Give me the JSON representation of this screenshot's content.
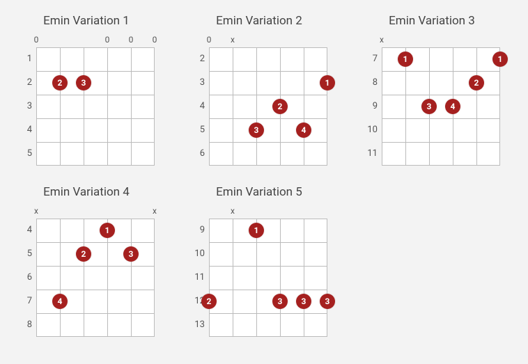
{
  "chart_data": [
    {
      "title": "Emin Variation 1",
      "frets": [
        1,
        2,
        3,
        4,
        5
      ],
      "markers": [
        "0",
        "",
        "",
        "0",
        "0",
        "0"
      ],
      "dots": [
        {
          "finger": "2",
          "string": 2,
          "fret": 2
        },
        {
          "finger": "3",
          "string": 3,
          "fret": 2
        }
      ]
    },
    {
      "title": "Emin Variation 2",
      "frets": [
        2,
        3,
        4,
        5,
        6
      ],
      "markers": [
        "0",
        "x",
        "",
        "",
        "",
        ""
      ],
      "dots": [
        {
          "finger": "1",
          "string": 6,
          "fret": 3
        },
        {
          "finger": "2",
          "string": 4,
          "fret": 4
        },
        {
          "finger": "3",
          "string": 3,
          "fret": 5
        },
        {
          "finger": "4",
          "string": 5,
          "fret": 5
        }
      ]
    },
    {
      "title": "Emin Variation 3",
      "frets": [
        7,
        8,
        9,
        10,
        11
      ],
      "markers": [
        "x",
        "",
        "",
        "",
        "",
        ""
      ],
      "dots": [
        {
          "finger": "1",
          "string": 2,
          "fret": 7
        },
        {
          "finger": "1",
          "string": 6,
          "fret": 7
        },
        {
          "finger": "2",
          "string": 5,
          "fret": 8
        },
        {
          "finger": "3",
          "string": 3,
          "fret": 9
        },
        {
          "finger": "4",
          "string": 4,
          "fret": 9
        }
      ]
    },
    {
      "title": "Emin Variation 4",
      "frets": [
        4,
        5,
        6,
        7,
        8
      ],
      "markers": [
        "x",
        "",
        "",
        "",
        "",
        "x"
      ],
      "dots": [
        {
          "finger": "1",
          "string": 4,
          "fret": 4
        },
        {
          "finger": "2",
          "string": 3,
          "fret": 5
        },
        {
          "finger": "3",
          "string": 5,
          "fret": 5
        },
        {
          "finger": "4",
          "string": 2,
          "fret": 7
        }
      ]
    },
    {
      "title": "Emin Variation 5",
      "frets": [
        9,
        10,
        11,
        12,
        13
      ],
      "markers": [
        "",
        "x",
        "",
        "",
        "",
        ""
      ],
      "dots": [
        {
          "finger": "1",
          "string": 3,
          "fret": 9
        },
        {
          "finger": "2",
          "string": 1,
          "fret": 12
        },
        {
          "finger": "3",
          "string": 4,
          "fret": 12
        },
        {
          "finger": "3",
          "string": 5,
          "fret": 12
        },
        {
          "finger": "3",
          "string": 6,
          "fret": 12
        }
      ]
    }
  ],
  "layout": {
    "cell": 34,
    "strings": 6,
    "rows": 5,
    "dot_color": "#a5201f"
  }
}
